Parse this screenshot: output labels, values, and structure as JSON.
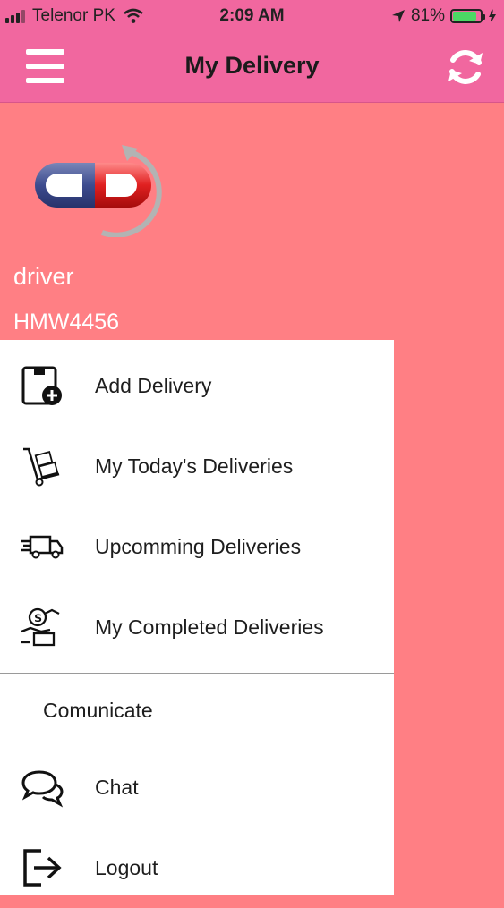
{
  "status_bar": {
    "carrier": "Telenor PK",
    "time": "2:09 AM",
    "battery": "81%",
    "battery_level": 0.81
  },
  "header": {
    "title": "My Delivery",
    "menu_icon": "hamburger-menu-icon",
    "refresh_icon": "refresh-icon"
  },
  "profile": {
    "name": "driver",
    "code": "HMW4456"
  },
  "menu": {
    "items": [
      {
        "label": "Add Delivery",
        "icon": "add-package-icon"
      },
      {
        "label": "My Today's Deliveries",
        "icon": "hand-truck-icon"
      },
      {
        "label": "Upcomming Deliveries",
        "icon": "delivery-truck-icon"
      },
      {
        "label": "My Completed Deliveries",
        "icon": "payment-hand-icon"
      }
    ],
    "section_title": "Comunicate",
    "comm_items": [
      {
        "label": "Chat",
        "icon": "chat-icon"
      },
      {
        "label": "Logout",
        "icon": "logout-icon"
      }
    ]
  },
  "colors": {
    "header_bg": "#f1679f",
    "body_bg": "#ff7f84",
    "drawer_bg": "#ffffff"
  }
}
